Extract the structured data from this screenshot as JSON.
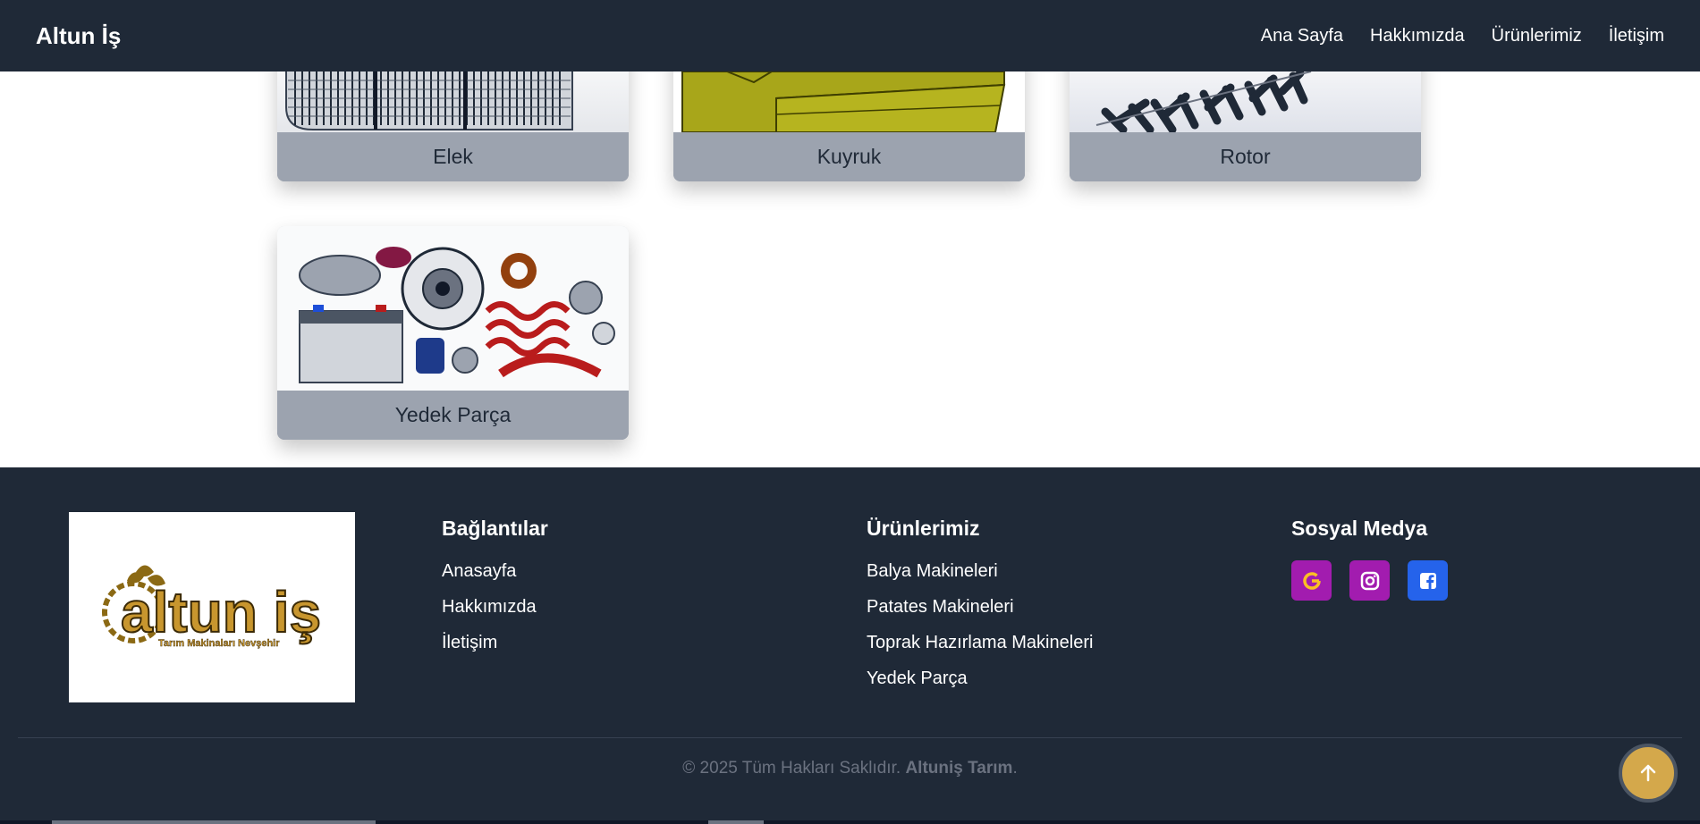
{
  "navbar": {
    "brand": "Altun İş",
    "links": [
      "Ana Sayfa",
      "Hakkımızda",
      "Ürünlerimiz",
      "İletişim"
    ]
  },
  "cards": [
    "Elek",
    "Kuyruk",
    "Rotor",
    "Yedek Parça"
  ],
  "footer": {
    "logo_text": "altun iş",
    "logo_subtext": "Tarım Makinaları Nevşehir",
    "links_title": "Bağlantılar",
    "links": [
      "Anasayfa",
      "Hakkımızda",
      "İletişim"
    ],
    "products_title": "Ürünlerimiz",
    "products": [
      "Balya Makineleri",
      "Patates Makineleri",
      "Toprak Hazırlama Makineleri",
      "Yedek Parça"
    ],
    "social_title": "Sosyal Medya",
    "social_icons": [
      "google-icon",
      "instagram-icon",
      "facebook-icon"
    ],
    "copyright_prefix": "© 2025 Tüm Hakları Saklıdır.",
    "copyright_brand": "Altuniş Tarım",
    "copyright_suffix": "."
  },
  "colors": {
    "navbar": "#1f2937",
    "card_label_bg": "#9ca3af",
    "gold": "#d4a84b",
    "google": "#a21caf",
    "instagram": "#a21caf",
    "facebook": "#2563eb"
  }
}
